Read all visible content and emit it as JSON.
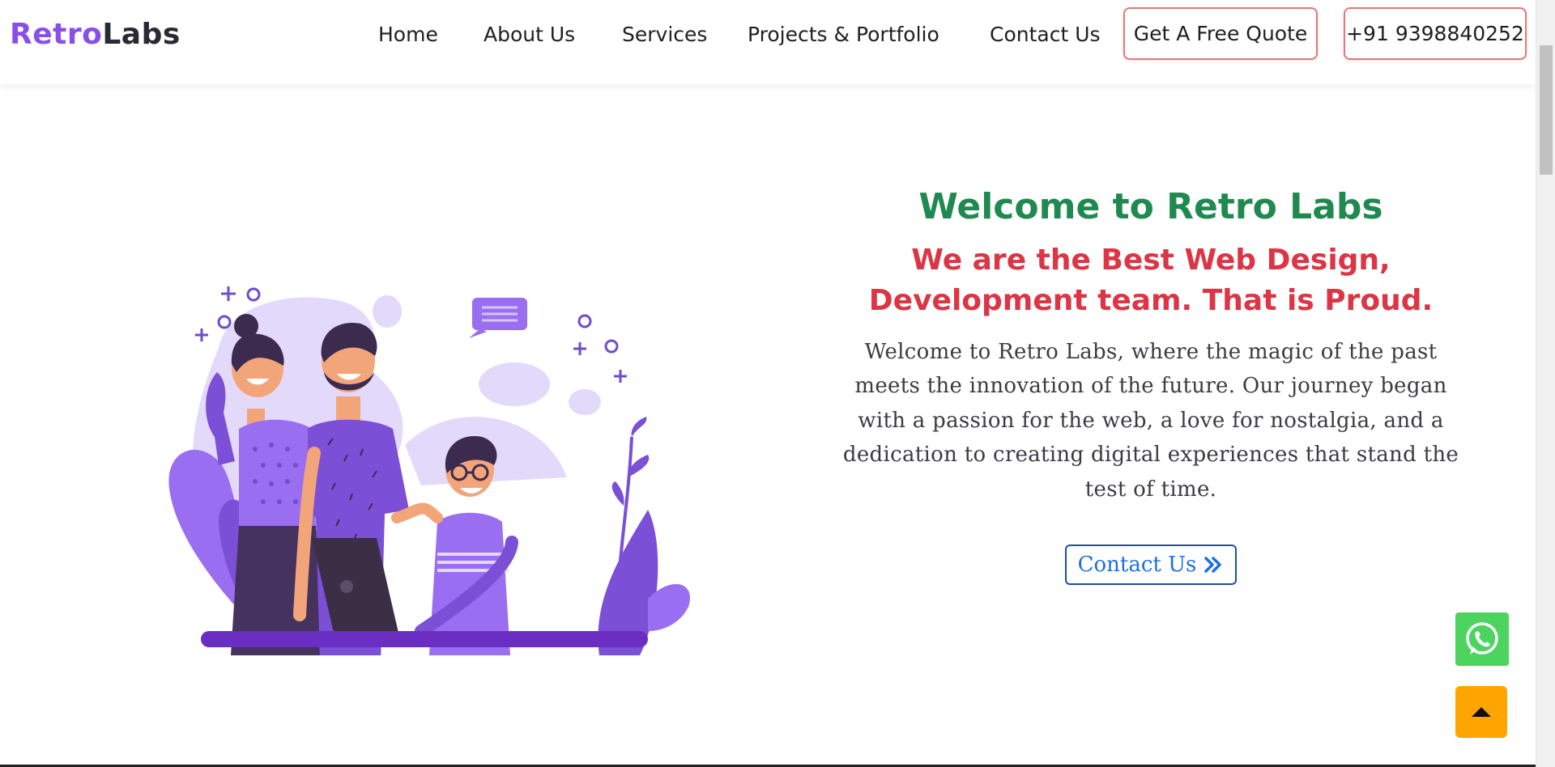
{
  "brand": {
    "logo_part1": "Retro",
    "logo_part2": "Labs",
    "color_primary": "#8a4fe8",
    "color_dark": "#2a2a35"
  },
  "nav": {
    "items": [
      {
        "label": "Home"
      },
      {
        "label": "About Us"
      },
      {
        "label": "Services"
      },
      {
        "label": "Projects & Portfolio"
      },
      {
        "label": "Contact Us"
      }
    ],
    "quote_button": "Get A Free Quote",
    "phone_button": "+91 9398840252"
  },
  "hero": {
    "title": "Welcome to Retro Labs",
    "subtitle": "We are the Best Web Design, Development team. That is Proud.",
    "description": "Welcome to Retro Labs, where the magic of the past meets the innovation of the future. Our journey began with a passion for the web, a love for nostalgia, and a dedication to creating digital experiences that stand the test of time.",
    "cta_label": "Contact Us",
    "title_color": "#1f8a50",
    "subtitle_color": "#dc3545"
  },
  "illustration": {
    "icon": "team-illustration",
    "accent": "#7b4fd6"
  },
  "floating": {
    "whatsapp_icon": "whatsapp-icon",
    "whatsapp_color": "#4cd45f",
    "scroll_top_icon": "caret-up-icon",
    "scroll_top_color": "#ffa500"
  }
}
